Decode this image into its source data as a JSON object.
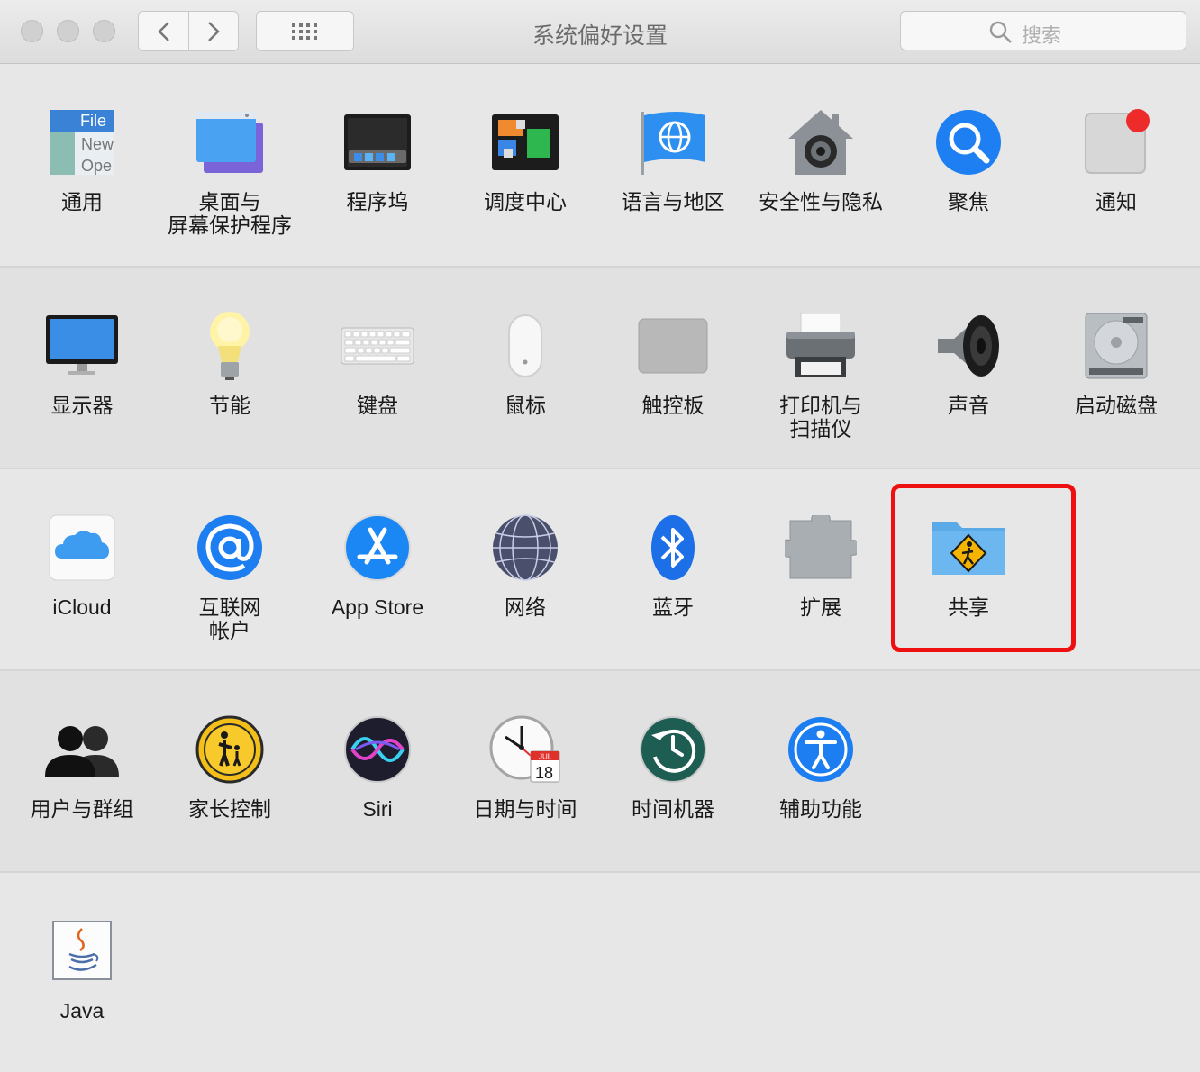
{
  "window": {
    "title": "系统偏好设置"
  },
  "toolbar": {
    "search_placeholder": "搜索"
  },
  "sections": [
    {
      "items": [
        {
          "label": "通用",
          "icon": "general-icon"
        },
        {
          "label": "桌面与\n屏幕保护程序",
          "icon": "desktop-screensaver-icon"
        },
        {
          "label": "程序坞",
          "icon": "dock-icon"
        },
        {
          "label": "调度中心",
          "icon": "mission-control-icon"
        },
        {
          "label": "语言与地区",
          "icon": "language-region-icon"
        },
        {
          "label": "安全性与隐私",
          "icon": "security-privacy-icon"
        },
        {
          "label": "聚焦",
          "icon": "spotlight-icon"
        },
        {
          "label": "通知",
          "icon": "notifications-icon"
        }
      ]
    },
    {
      "items": [
        {
          "label": "显示器",
          "icon": "displays-icon"
        },
        {
          "label": "节能",
          "icon": "energy-saver-icon"
        },
        {
          "label": "键盘",
          "icon": "keyboard-icon"
        },
        {
          "label": "鼠标",
          "icon": "mouse-icon"
        },
        {
          "label": "触控板",
          "icon": "trackpad-icon"
        },
        {
          "label": "打印机与\n扫描仪",
          "icon": "printers-scanners-icon"
        },
        {
          "label": "声音",
          "icon": "sound-icon"
        },
        {
          "label": "启动磁盘",
          "icon": "startup-disk-icon"
        }
      ]
    },
    {
      "items": [
        {
          "label": "iCloud",
          "icon": "icloud-icon"
        },
        {
          "label": "互联网\n帐户",
          "icon": "internet-accounts-icon"
        },
        {
          "label": "App Store",
          "icon": "app-store-icon"
        },
        {
          "label": "网络",
          "icon": "network-icon"
        },
        {
          "label": "蓝牙",
          "icon": "bluetooth-icon"
        },
        {
          "label": "扩展",
          "icon": "extensions-icon"
        },
        {
          "label": "共享",
          "icon": "sharing-icon"
        }
      ]
    },
    {
      "items": [
        {
          "label": "用户与群组",
          "icon": "users-groups-icon"
        },
        {
          "label": "家长控制",
          "icon": "parental-controls-icon"
        },
        {
          "label": "Siri",
          "icon": "siri-icon"
        },
        {
          "label": "日期与时间",
          "icon": "date-time-icon"
        },
        {
          "label": "时间机器",
          "icon": "time-machine-icon"
        },
        {
          "label": "辅助功能",
          "icon": "accessibility-icon"
        }
      ]
    },
    {
      "items": [
        {
          "label": "Java",
          "icon": "java-icon"
        }
      ]
    }
  ],
  "icon_text": {
    "general_file": "File",
    "general_new": "New",
    "general_open": "Ope",
    "calendar_month": "JUL",
    "calendar_day": "18"
  },
  "colors": {
    "highlight": "#ee1010",
    "accent_blue": "#1e7bf0"
  }
}
